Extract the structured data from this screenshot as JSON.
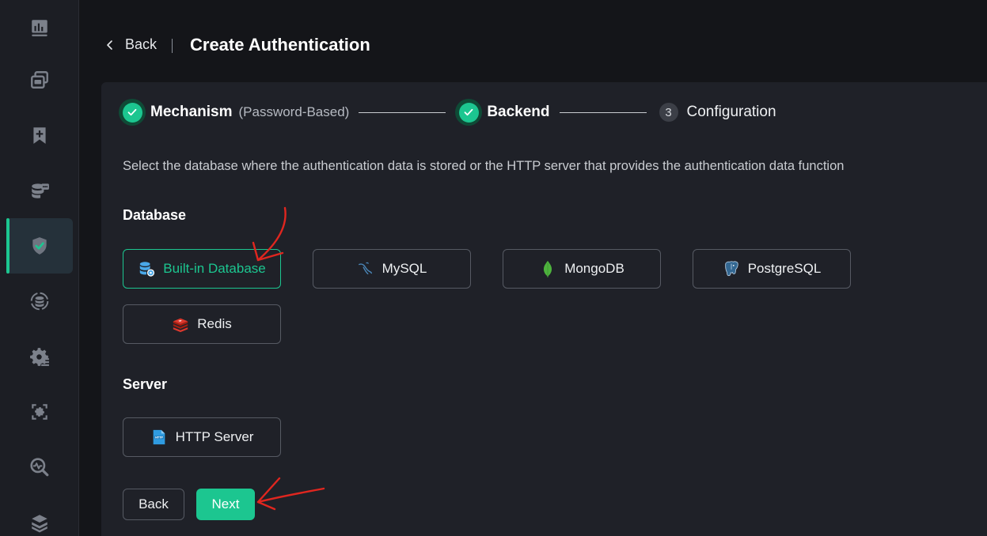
{
  "header": {
    "back_label": "Back",
    "title": "Create Authentication"
  },
  "sidebar": {
    "items": [
      {
        "name": "dashboard-icon",
        "active": false
      },
      {
        "name": "connections-icon",
        "active": false
      },
      {
        "name": "topics-icon",
        "active": false
      },
      {
        "name": "integration-icon",
        "active": false
      },
      {
        "name": "access-control-icon",
        "active": true
      },
      {
        "name": "data-sync-icon",
        "active": false
      },
      {
        "name": "management-icon",
        "active": false
      },
      {
        "name": "extensions-icon",
        "active": false
      },
      {
        "name": "diagnose-icon",
        "active": false
      },
      {
        "name": "system-icon",
        "active": false
      }
    ]
  },
  "steps": [
    {
      "title": "Mechanism",
      "subtitle": "(Password-Based)",
      "status": "done"
    },
    {
      "title": "Backend",
      "status": "done"
    },
    {
      "number": "3",
      "title": "Configuration",
      "status": "pending"
    }
  ],
  "description": "Select the database where the authentication data is stored or the HTTP server that provides the authentication data function",
  "sections": {
    "database_title": "Database",
    "server_title": "Server"
  },
  "database_options": [
    {
      "label": "Built-in Database",
      "icon": "built-in-database-icon",
      "selected": true
    },
    {
      "label": "MySQL",
      "icon": "mysql-icon",
      "selected": false
    },
    {
      "label": "MongoDB",
      "icon": "mongodb-icon",
      "selected": false
    },
    {
      "label": "PostgreSQL",
      "icon": "postgresql-icon",
      "selected": false
    },
    {
      "label": "Redis",
      "icon": "redis-icon",
      "selected": false
    }
  ],
  "server_options": [
    {
      "label": "HTTP Server",
      "icon": "http-server-icon",
      "selected": false
    }
  ],
  "footer": {
    "back_label": "Back",
    "next_label": "Next"
  },
  "colors": {
    "accent": "#1cc690",
    "background": "#141519",
    "panel": "#1f2128",
    "annotation": "#e0261f"
  }
}
